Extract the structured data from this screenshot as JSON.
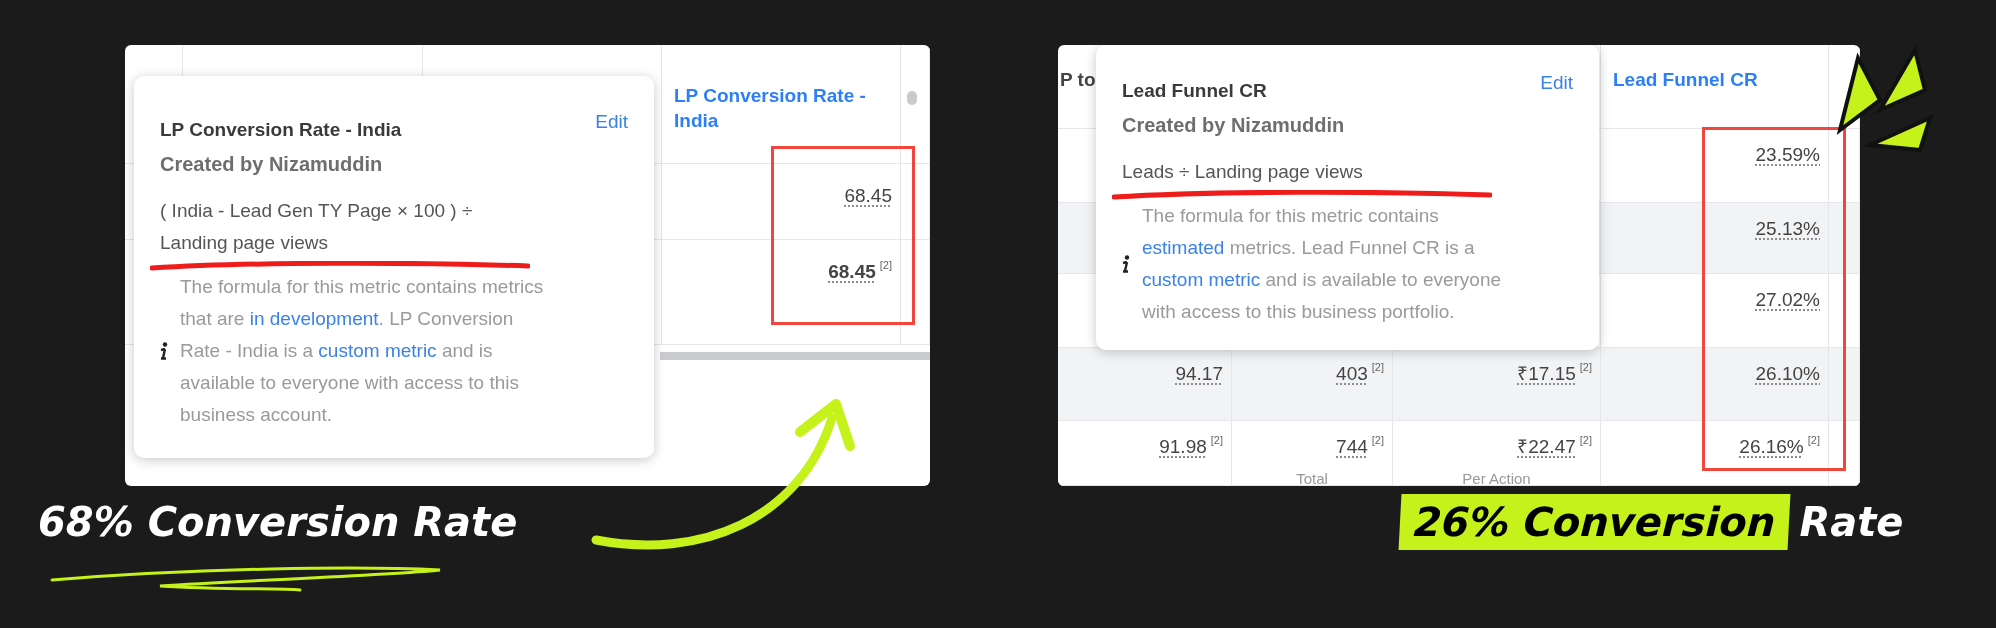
{
  "panels": [
    {
      "table": {
        "columns": [
          {},
          {},
          {},
          {
            "header": "LP Conversion Rate - India"
          },
          {
            "kind": "icon"
          }
        ],
        "rows": [
          {
            "striped": false,
            "cells": [
              null,
              null,
              null,
              {
                "value": "68.45",
                "bold": false
              },
              null
            ]
          },
          {
            "striped": false,
            "cells": [
              null,
              null,
              null,
              {
                "value": "68.45",
                "bold": true,
                "note": "[2]"
              },
              null
            ]
          }
        ]
      },
      "tooltip": {
        "title": "LP Conversion Rate - India",
        "edit": "Edit",
        "author": "Created by Nizamuddin",
        "formula": "( India - Lead Gen TY Page × 100 ) ÷ Landing page views",
        "description": [
          {
            "text": "The formula for this metric contains metrics that are",
            "link": false
          },
          {
            "text": "in development",
            "link": true
          },
          {
            "text": ". LP Conversion Rate - India is a",
            "link": false
          },
          {
            "text": "custom metric",
            "link": true
          },
          {
            "text": "and is available to everyone with access to this business account.",
            "link": false
          }
        ]
      },
      "caption": [
        {
          "text": "68% Conversion Rate",
          "highlighted": false
        }
      ]
    },
    {
      "table": {
        "columns": [
          {
            "header": "P to"
          },
          {},
          {},
          {
            "header": "Lead Funnel CR"
          },
          {}
        ],
        "rows": [
          {
            "striped": false,
            "cells": [
              null,
              null,
              null,
              {
                "value": "23.59%",
                "bold": false
              }
            ]
          },
          {
            "striped": true,
            "cells": [
              null,
              null,
              null,
              {
                "value": "25.13%",
                "bold": false
              }
            ]
          },
          {
            "striped": false,
            "cells": [
              null,
              null,
              null,
              {
                "value": "27.02%",
                "bold": false
              }
            ]
          },
          {
            "striped": true,
            "cells": [
              {
                "value": "94.17",
                "bold": false
              },
              {
                "value": "403",
                "bold": false,
                "note": "[2]"
              },
              {
                "value": "₹17.15",
                "bold": false,
                "note": "[2]"
              },
              {
                "value": "26.10%",
                "bold": false
              }
            ]
          },
          {
            "striped": false,
            "cells": [
              {
                "value": "91.98",
                "bold": false,
                "note": "[2]"
              },
              {
                "value": "744",
                "bold": false,
                "note": "[2]",
                "sub": "Total"
              },
              {
                "value": "₹22.47",
                "bold": false,
                "note": "[2]",
                "sub": "Per Action"
              },
              {
                "value": "26.16%",
                "bold": false,
                "note": "[2]"
              }
            ]
          }
        ]
      },
      "tooltip": {
        "title": "Lead Funnel CR",
        "edit": "Edit",
        "author": "Created by Nizamuddin",
        "formula": "Leads ÷ Landing page views",
        "description": [
          {
            "text": "The formula for this metric contains",
            "link": false
          },
          {
            "text": "estimated",
            "link": true
          },
          {
            "text": "metrics. Lead Funnel CR is a",
            "link": false
          },
          {
            "text": "custom metric",
            "link": true
          },
          {
            "text": "and is available to everyone with access to this business portfolio.",
            "link": false
          }
        ]
      },
      "caption": [
        {
          "text": "26% Conversion",
          "highlighted": true
        },
        {
          "text": "Rate",
          "highlighted": false
        }
      ]
    }
  ]
}
